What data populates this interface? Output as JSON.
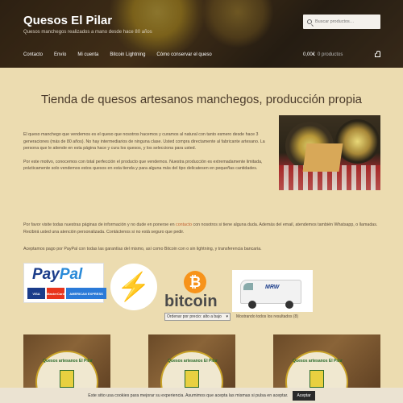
{
  "header": {
    "site_title": "Quesos El Pilar",
    "tagline": "Quesos manchegos realizados a mano desde hace 80 años",
    "search_placeholder": "Buscar productos…",
    "nav": [
      "Contacto",
      "Envío",
      "Mi cuenta",
      "Bitcoin Lightning",
      "Cómo conservar el queso"
    ],
    "cart_total": "0,00€",
    "cart_count": "0 productos"
  },
  "main": {
    "title": "Tienda de quesos artesanos manchegos, producción propia",
    "intro_1": "El queso manchego que vendemos es el queso que nosotros hacemos y curamos al natural con tanto esmero desde hace 3 generaciones (más de 80 años). No hay intermediarios de ninguna clase. Usted compra directamente al fabricante artesano. La persona que le atiende en esta página hace y cura los quesos, y los selecciona para usted.",
    "intro_2": "Por este motivo, conocemos con total perfección el producto que vendemos. Nuestra producción es extremadamente limitada, prácticamente solo vendemos estos quesos en esta tienda y para alguna más del tipo delicatesen en pequeñas cantidades.",
    "contact_pre": "Por favor visite todas nuestras páginas de información y no dude en ponerse en ",
    "contact_link": "contacto",
    "contact_post": " con nosotros si tiene alguna duda. Además del email, atendemos también Whatsapp, o llamadas. Recibirá usted una atención personalizada. Contáctenos si no está seguro que pedir.",
    "payments_text": "Aceptamos pago por PayPal con todas las garantías del mismo, así como Bitcoin con o sin lightning, y transferencia bancaria."
  },
  "payments": {
    "paypal_pay": "Pay",
    "paypal_pal": "Pal",
    "cards": [
      "VISA",
      "MasterCard",
      "AMERICAN EXPRESS"
    ],
    "bolt_symbol": "⚡",
    "bitcoin_symbol": "₿",
    "bitcoin_word": "bitcoin",
    "courier": "MRW"
  },
  "shop": {
    "sort_selected": "Ordenar por precio: alto a bajo",
    "result_count": "Mostrando todos los resultados (8)",
    "product_label_text": "Quesos artesanos El Pilar"
  },
  "cookie": {
    "text": "Este sitio usa cookies para mejorar su experiencia. Asumimos que acepta las mismas si pulsa en aceptar.",
    "accept": "Aceptar"
  }
}
